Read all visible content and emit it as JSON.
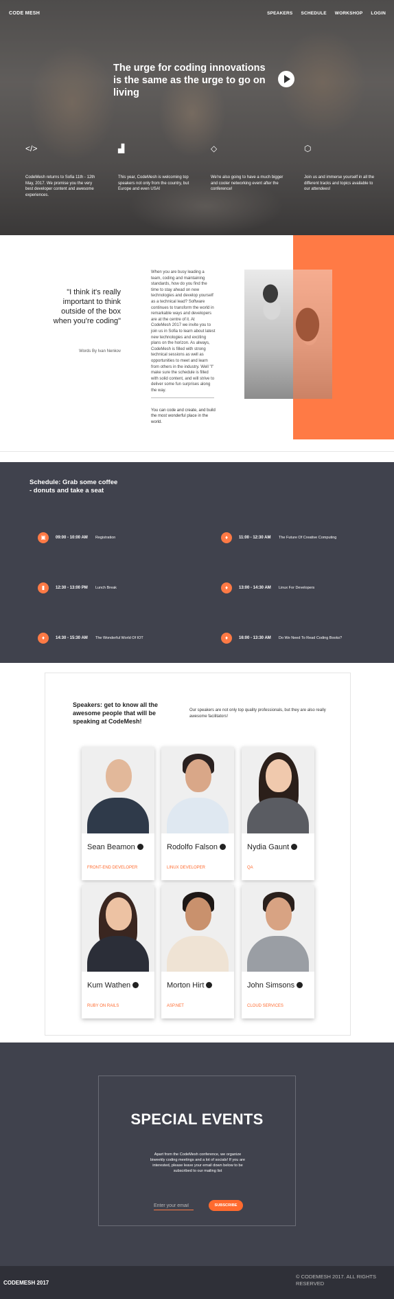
{
  "header": {
    "logo": "CODE MESH",
    "nav": [
      "SPEAKERS",
      "SCHEDULE",
      "WORKSHOP",
      "LOGIN"
    ]
  },
  "hero": {
    "title": "The urge for coding innovations is the same as the urge to go on living",
    "play_icon": "play-icon"
  },
  "features": [
    {
      "icon": "code-icon",
      "glyph": "</>",
      "text": "CodeMesh returns to Sofia 11th - 12th May, 2017. We promise you the very best developer content and awesome experiences."
    },
    {
      "icon": "chart-icon",
      "glyph": "▟",
      "text": "This year, CodeMesh is welcoming top speakers not only from the country, but Europe and even USA!"
    },
    {
      "icon": "diamond-icon",
      "glyph": "◇",
      "text": "We're also going to have a much bigger and cooler networking event after the conference!"
    },
    {
      "icon": "cube-icon",
      "glyph": "⬡",
      "text": "Join us and immerse yourself in all the different tracks and topics available to our attendees!"
    }
  ],
  "about": {
    "quote": "\"I think it's really important to think outside of the box when you're coding\"",
    "quote_by": "Words By Ivan Nenkov",
    "text": "When you are busy leading a team, coding and maintaining standards, how do you find the time to stay ahead on new technologies and develop yourself as a technical lead? Software continues to transform the world in remarkable ways and developers are at the centre of it. At CodeMesh 2017 we invite you to join us in Sofia to learn about latest new technologies and exciting plans on the horizon. As always, CodeMesh is filled with strong technical sessions as well as opportunities to meet and learn from others in the industry. Well \"I\" make sure the schedule is filled with solid content, and will strive to deliver some fun surprises along the way.",
    "footer": "You can code and create, and build the most wonderful place in the world."
  },
  "schedule": {
    "title": "Schedule: Grab some coffee - donuts and take a seat",
    "items": [
      {
        "icon": "calendar-icon",
        "glyph": "▣",
        "time": "09:00 - 10:00 AM",
        "name": "Registration"
      },
      {
        "icon": "flame-icon",
        "glyph": "♦",
        "time": "11:00 - 12:30 AM",
        "name": "The Future Of Creative Computing"
      },
      {
        "icon": "coffee-icon",
        "glyph": "▮",
        "time": "12:30 - 13:00 PM",
        "name": "Lunch Break"
      },
      {
        "icon": "flame-icon",
        "glyph": "♦",
        "time": "13:00 - 14:30 AM",
        "name": "Linux For Developers"
      },
      {
        "icon": "flame-icon",
        "glyph": "♦",
        "time": "14:30 - 15:30 AM",
        "name": "The Wonderful World Of IOT"
      },
      {
        "icon": "flame-icon",
        "glyph": "♦",
        "time": "16:00 - 13:30 AM",
        "name": "Do We Need To Read Coding Books?"
      }
    ]
  },
  "speakers": {
    "title": "Speakers: get to know all the awesome people that will be speaking at CodeMesh!",
    "subtitle": "Our speakers are not only top quality professionals, but they are also really awesome facilitators!",
    "people": [
      {
        "name": "Sean Beamon",
        "role": "FRONT-END DEVELOPER",
        "skin": "#e2b89a",
        "hair": "#caa58c",
        "shirt": "#2f3a4a"
      },
      {
        "name": "Rodolfo Falson",
        "role": "LINUX DEVELOPER",
        "skin": "#d9a788",
        "hair": "#2a2120",
        "shirt": "#dfe8f1"
      },
      {
        "name": "Nydia Gaunt",
        "role": "QA",
        "skin": "#f0c9ad",
        "hair": "#2b1f1a",
        "shirt": "#5a5c62"
      },
      {
        "name": "Kum Wathen",
        "role": "RUBY ON RAILS",
        "skin": "#edc2a3",
        "hair": "#3a2620",
        "shirt": "#2b2e38"
      },
      {
        "name": "Morton Hirt",
        "role": "ASP.NET",
        "skin": "#c9916d",
        "hair": "#1d1715",
        "shirt": "#efe3d4"
      },
      {
        "name": "John Simsons",
        "role": "CLOUD SERVICES",
        "skin": "#d8a383",
        "hair": "#2a201c",
        "shirt": "#9a9ea4"
      }
    ]
  },
  "events": {
    "title": "SPECIAL EVENTS",
    "text": "Apart from the CodeMesh conference, we organize biweekly coding meetings and a lot of socials! If you are interested, please leave your email down below to be subscribed to our mailing list",
    "email_placeholder": "Enter your email",
    "subscribe_label": "SUBSCRIBE"
  },
  "footer": {
    "left": "CODEMESH 2017",
    "right": "© CODEMESH 2017. ALL RIGHTS RESERVED"
  },
  "colors": {
    "accent": "#ff7a45",
    "dark": "#40424d",
    "footer": "#2f3038"
  }
}
